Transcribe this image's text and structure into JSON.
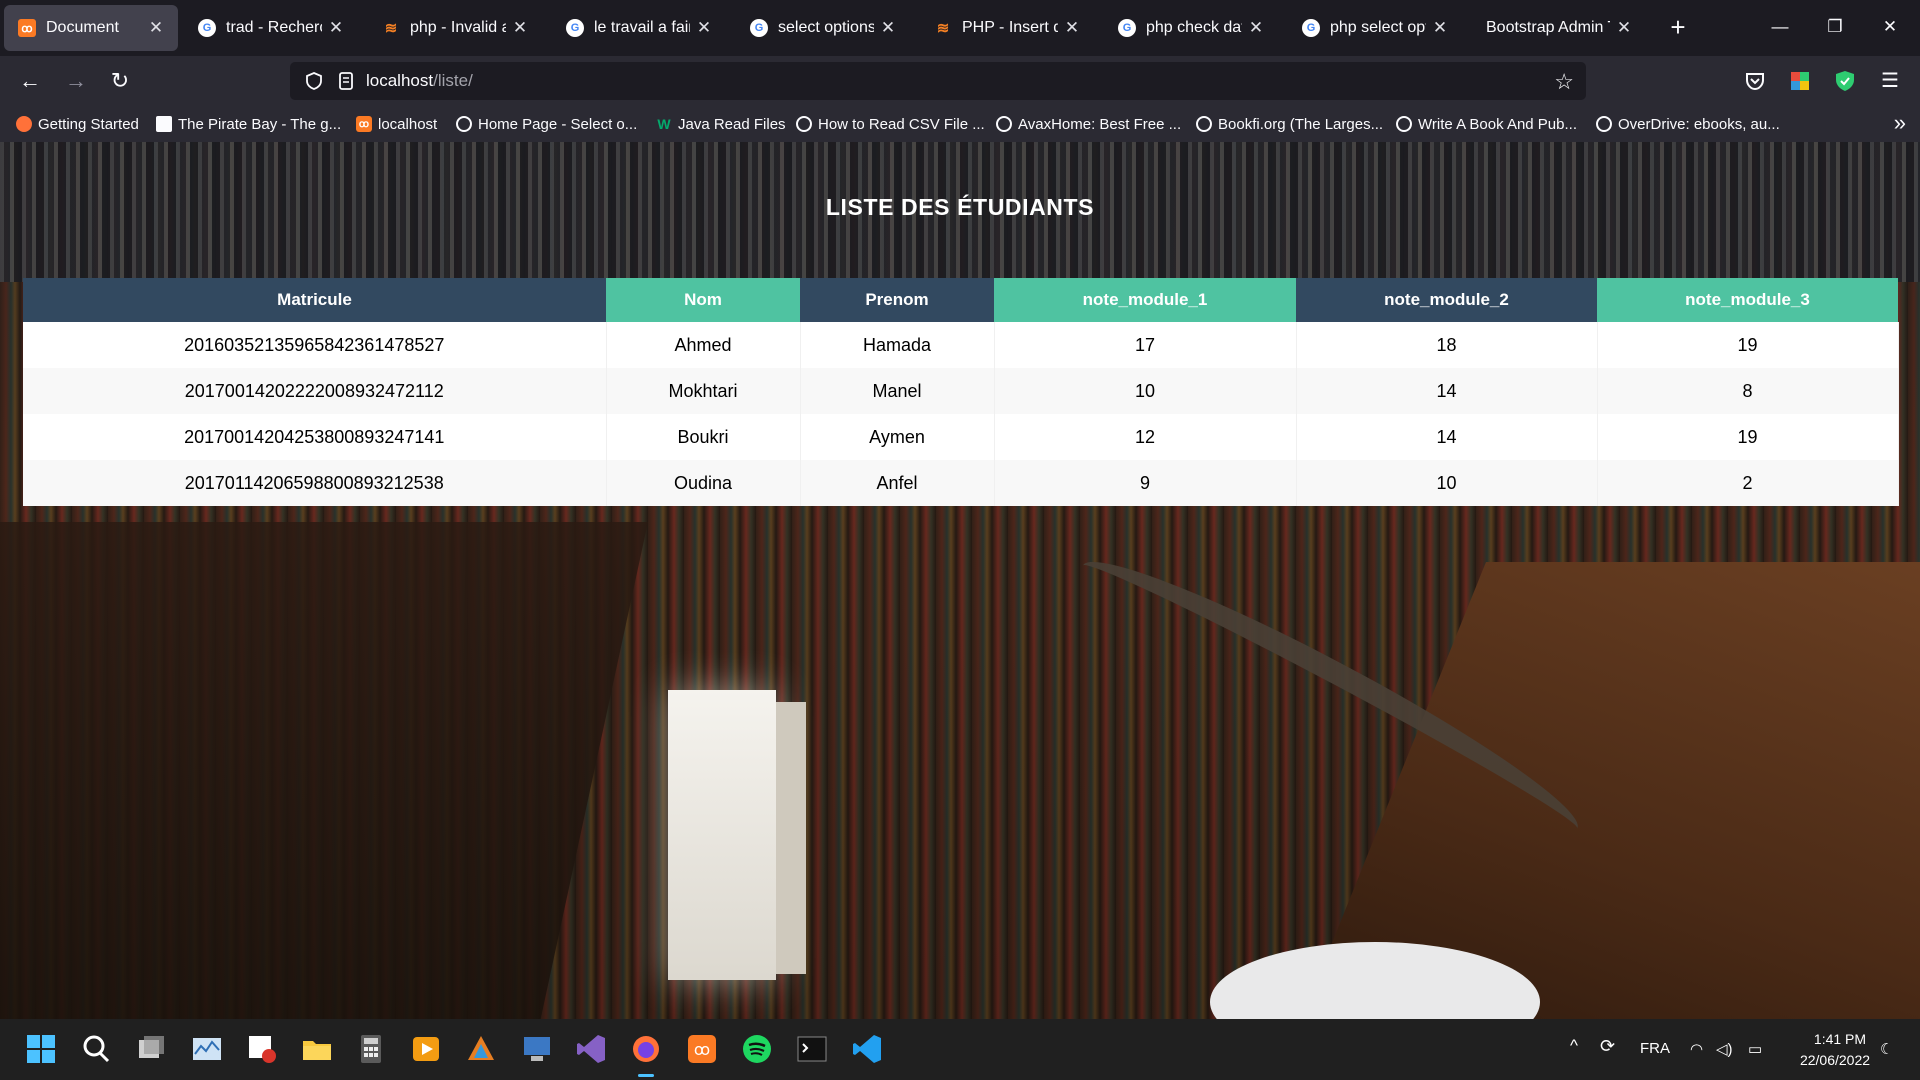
{
  "browser": {
    "tabs": [
      {
        "title": "Document",
        "icon": "xampp-icon",
        "active": true
      },
      {
        "title": "trad - Recherche",
        "icon": "google-icon"
      },
      {
        "title": "php - Invalid arg",
        "icon": "stackoverflow-icon"
      },
      {
        "title": "le travail a faire -",
        "icon": "google-icon"
      },
      {
        "title": "select options htr",
        "icon": "google-icon"
      },
      {
        "title": "PHP - Insert date",
        "icon": "stackoverflow-icon"
      },
      {
        "title": "php check date g",
        "icon": "google-icon"
      },
      {
        "title": "php select optior",
        "icon": "google-icon"
      },
      {
        "title": "Bootstrap Admin The",
        "icon": "none"
      }
    ],
    "url_host": "localhost",
    "url_path": "/liste/",
    "bookmarks": [
      {
        "label": "Getting Started",
        "icon": "firefox-icon"
      },
      {
        "label": "The Pirate Bay - The g...",
        "icon": "pirate-icon"
      },
      {
        "label": "localhost",
        "icon": "xampp-icon"
      },
      {
        "label": "Home Page - Select o...",
        "icon": "globe-icon"
      },
      {
        "label": "Java Read Files",
        "icon": "w3-icon"
      },
      {
        "label": "How to Read CSV File ...",
        "icon": "globe-icon"
      },
      {
        "label": "AvaxHome: Best Free ...",
        "icon": "globe-icon"
      },
      {
        "label": "Bookfi.org (The Larges...",
        "icon": "globe-icon"
      },
      {
        "label": "Write A Book And Pub...",
        "icon": "globe-icon"
      },
      {
        "label": "OverDrive: ebooks, au...",
        "icon": "globe-icon"
      }
    ]
  },
  "page": {
    "title": "LISTE DES ÉTUDIANTS",
    "columns": [
      "Matricule",
      "Nom",
      "Prenom",
      "note_module_1",
      "note_module_2",
      "note_module_3"
    ],
    "rows": [
      [
        "20160352135965842361478527",
        "Ahmed",
        "Hamada",
        "17",
        "18",
        "19"
      ],
      [
        "20170014202222008932472112",
        "Mokhtari",
        "Manel",
        "10",
        "14",
        "8"
      ],
      [
        "20170014204253800893247141",
        "Boukri",
        "Aymen",
        "12",
        "14",
        "19"
      ],
      [
        "20170114206598800893212538",
        "Oudina",
        "Anfel",
        "9",
        "10",
        "2"
      ]
    ]
  },
  "taskbar": {
    "language": "FRA",
    "time": "1:41 PM",
    "date": "22/06/2022",
    "apps": [
      "windows-start-icon",
      "search-icon",
      "task-view-icon",
      "resource-monitor-icon",
      "snipping-tool-icon",
      "file-explorer-icon",
      "calculator-icon",
      "media-player-icon",
      "app-icon",
      "network-app-icon",
      "visual-studio-icon",
      "firefox-icon",
      "xampp-icon",
      "spotify-icon",
      "terminal-icon",
      "vscode-icon"
    ]
  },
  "colors": {
    "header_dark": "#324960",
    "header_green": "#4fc3a1"
  }
}
